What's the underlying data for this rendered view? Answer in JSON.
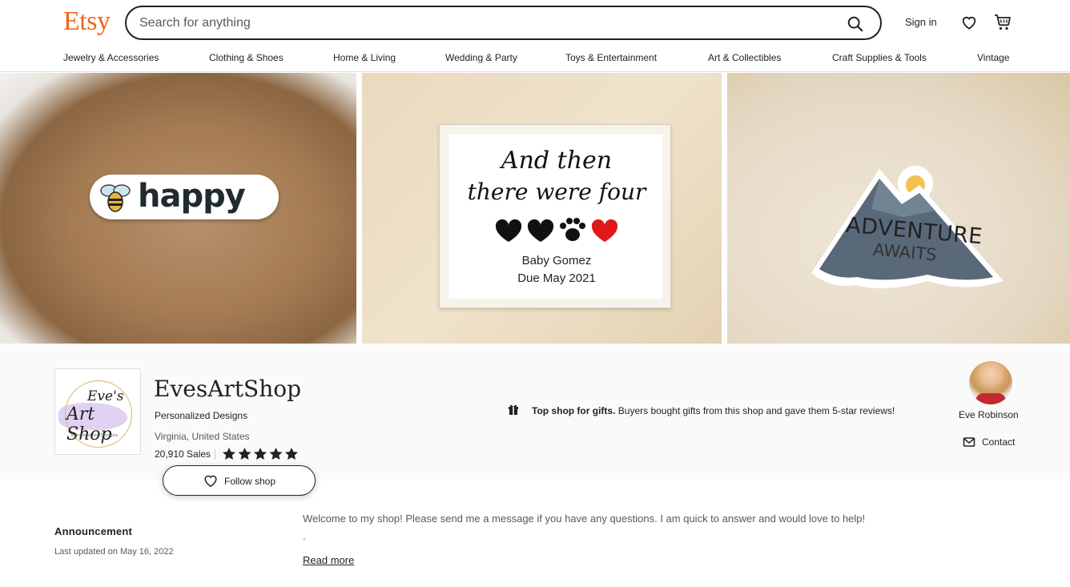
{
  "header": {
    "logo": "Etsy",
    "search_placeholder": "Search for anything",
    "sign_in": "Sign in",
    "icons": {
      "search": "search-icon",
      "favorites": "heart-icon",
      "cart": "cart-icon"
    },
    "brand_color": "#f1641e"
  },
  "categories": [
    "Jewelry & Accessories",
    "Clothing & Shoes",
    "Home & Living",
    "Wedding & Party",
    "Toys & Entertainment",
    "Art & Collectibles",
    "Craft Supplies & Tools",
    "Vintage"
  ],
  "banner": {
    "panel1": {
      "sticker_text": "happy"
    },
    "panel2": {
      "line1": "And then",
      "line2": "there were four",
      "line3": "Baby Gomez",
      "line4": "Due May 2021"
    },
    "panel3": {
      "line1": "ADVENTURE",
      "line2": "AWAITS"
    }
  },
  "shop": {
    "logo_line1": "Eve's",
    "logo_line2": "Art Shop",
    "logo_line3": "Personalized Designs",
    "name": "EvesArtShop",
    "tagline": "Personalized Designs",
    "location": "Virginia, United States",
    "sales": "20,910 Sales",
    "rating_stars": 5,
    "badge_bold": "Top shop for gifts.",
    "badge_text": " Buyers bought gifts from this shop and gave them 5-star reviews!",
    "owner_name": "Eve Robinson",
    "contact_label": "Contact",
    "follow_label": "Follow shop"
  },
  "announcement": {
    "title": "Announcement",
    "last_updated": "Last updated on May 16, 2022",
    "text": "Welcome to my shop! Please send me a message if you have any questions. I am quick to answer and would love to help!",
    "extra": ".",
    "read_more": "Read more"
  }
}
